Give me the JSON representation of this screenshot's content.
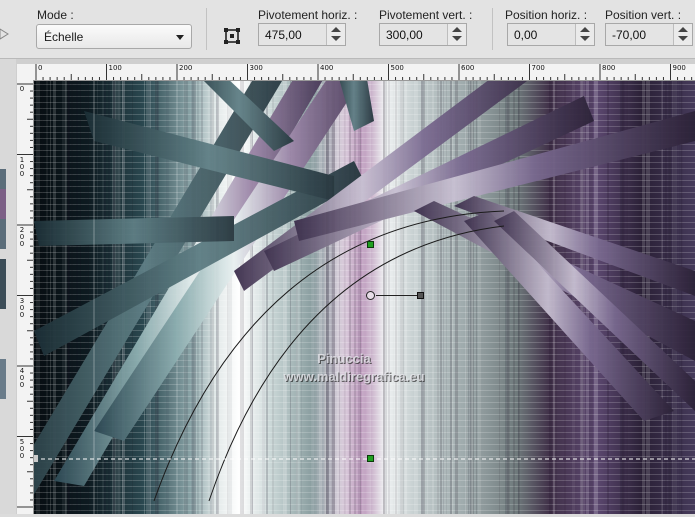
{
  "toolbar": {
    "mode_label": "Mode :",
    "mode_value": "Échelle",
    "pivot_h_label": "Pivotement horiz. :",
    "pivot_h_value": "475,00",
    "pivot_v_label": "Pivotement vert. :",
    "pivot_v_value": "300,00",
    "pos_h_label": "Position horiz. :",
    "pos_h_value": "0,00",
    "pos_v_label": "Position vert. :",
    "pos_v_value": "-70,00"
  },
  "ruler": {
    "h_labels": [
      "0",
      "100",
      "200",
      "300",
      "400",
      "500",
      "600",
      "700",
      "800",
      "900"
    ],
    "v_labels": [
      "0",
      "1\n0\n0",
      "2\n0\n0",
      "3\n0\n0",
      "4\n0\n0",
      "5\n0\n0"
    ]
  },
  "watermark": {
    "line1": "Pinuccia",
    "line2": "www.maldiregrafica.eu"
  },
  "colors": {
    "toolbar_bg": "#e3e3e3",
    "accent_handle": "#00a000"
  }
}
